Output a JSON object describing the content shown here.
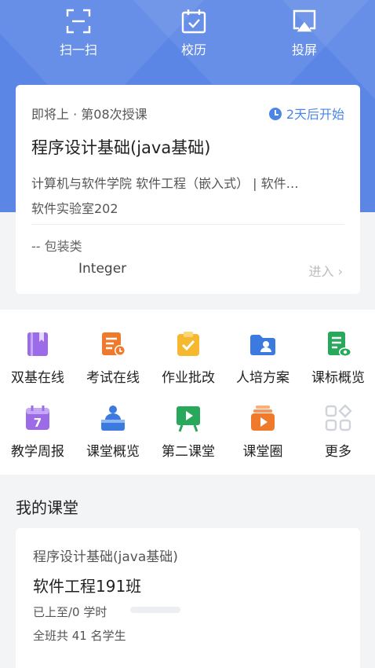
{
  "toolbar": {
    "scan_label": "扫一扫",
    "calendar_label": "校历",
    "cast_label": "投屏"
  },
  "upcoming": {
    "status": "即将上 · 第08次授课",
    "starts_in": "2天后开始",
    "course": "程序设计基础(java基础)",
    "department": "计算机与软件学院 软件工程（嵌入式） | 软件…",
    "room": "软件实验室202",
    "knowledge_point": "-- 包装类",
    "sub_topic": "Integer",
    "enter_label": "进入 ›"
  },
  "apps": [
    {
      "label": "双基在线",
      "icon": "book-icon",
      "color": "#9b6be8"
    },
    {
      "label": "考试在线",
      "icon": "exam-icon",
      "color": "#f07a2c"
    },
    {
      "label": "作业批改",
      "icon": "clipboard-check-icon",
      "color": "#f5b82e"
    },
    {
      "label": "人培方案",
      "icon": "folder-user-icon",
      "color": "#3b7be0"
    },
    {
      "label": "课标概览",
      "icon": "doc-eye-icon",
      "color": "#27a85a"
    },
    {
      "label": "教学周报",
      "icon": "calendar-7-icon",
      "color": "#9b6be8"
    },
    {
      "label": "课堂概览",
      "icon": "podium-icon",
      "color": "#3b7be0"
    },
    {
      "label": "第二课堂",
      "icon": "board-play-icon",
      "color": "#27a85a"
    },
    {
      "label": "课堂圈",
      "icon": "video-stack-icon",
      "color": "#f07a2c"
    },
    {
      "label": "更多",
      "icon": "grid-more-icon",
      "color": "#cfd3da"
    }
  ],
  "my_class": {
    "section_title": "我的课堂",
    "course": "程序设计基础(java基础)",
    "class_name": "软件工程191班",
    "progress_text": "已上至/0 学时",
    "progress": 0,
    "students": "全班共 41 名学生"
  }
}
